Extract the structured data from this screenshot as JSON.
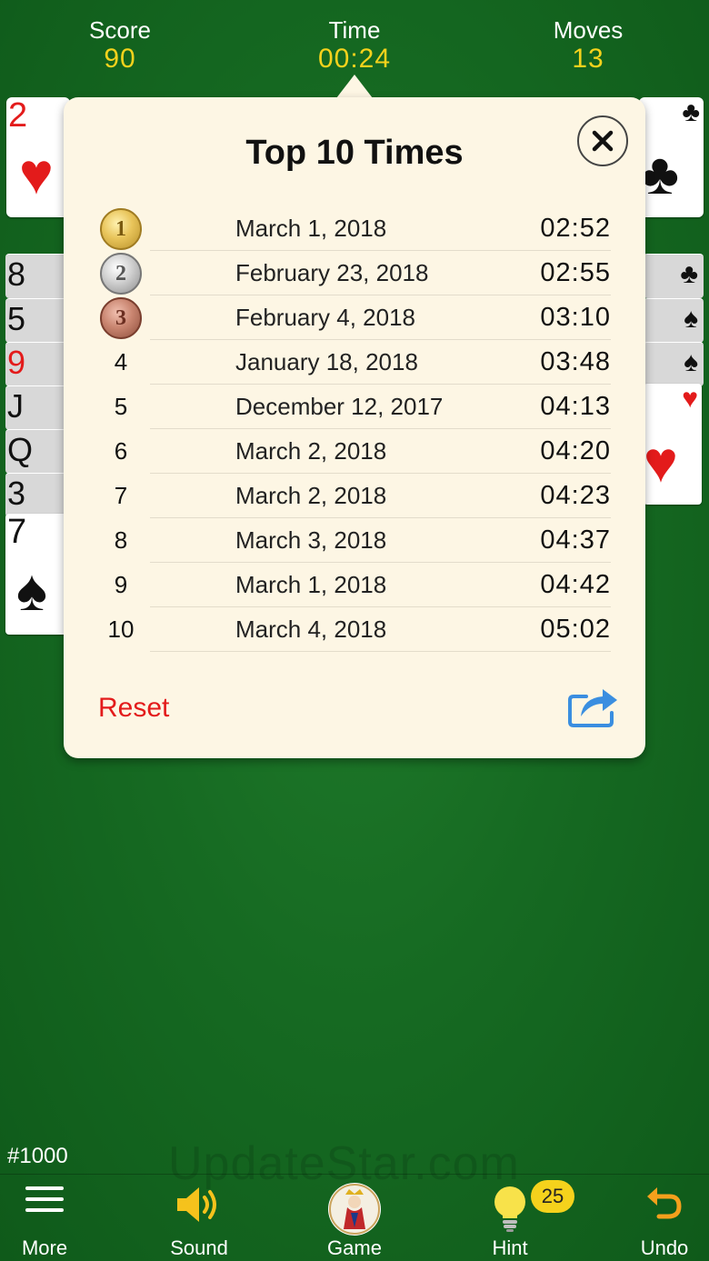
{
  "header": {
    "score_label": "Score",
    "score_value": "90",
    "time_label": "Time",
    "time_value": "00:24",
    "moves_label": "Moves",
    "moves_value": "13"
  },
  "cards": {
    "foundation_left_rank": "2",
    "left_stack_ranks": [
      "8",
      "5",
      "9",
      "J",
      "Q",
      "3",
      "7"
    ]
  },
  "popup": {
    "title": "Top 10 Times",
    "close_icon": "close-icon",
    "rows": [
      {
        "rank": "1",
        "medal": "gold",
        "date": "March 1, 2018",
        "time": "02:52"
      },
      {
        "rank": "2",
        "medal": "silver",
        "date": "February 23, 2018",
        "time": "02:55"
      },
      {
        "rank": "3",
        "medal": "bronze",
        "date": "February 4, 2018",
        "time": "03:10"
      },
      {
        "rank": "4",
        "date": "January 18, 2018",
        "time": "03:48"
      },
      {
        "rank": "5",
        "date": "December 12, 2017",
        "time": "04:13"
      },
      {
        "rank": "6",
        "date": "March 2, 2018",
        "time": "04:20"
      },
      {
        "rank": "7",
        "date": "March 2, 2018",
        "time": "04:23"
      },
      {
        "rank": "8",
        "date": "March 3, 2018",
        "time": "04:37"
      },
      {
        "rank": "9",
        "date": "March 1, 2018",
        "time": "04:42"
      },
      {
        "rank": "10",
        "date": "March 4, 2018",
        "time": "05:02"
      }
    ],
    "reset_label": "Reset",
    "share_icon": "share-icon"
  },
  "game_number": "#1000",
  "watermark": "UpdateStar.com",
  "toolbar": {
    "more_label": "More",
    "sound_label": "Sound",
    "game_label": "Game",
    "hint_label": "Hint",
    "hint_count": "25",
    "undo_label": "Undo"
  },
  "colors": {
    "felt": "#166a22",
    "accent_yellow": "#f5d21c",
    "popup_bg": "#fdf6e4",
    "reset_red": "#e31b1b"
  }
}
